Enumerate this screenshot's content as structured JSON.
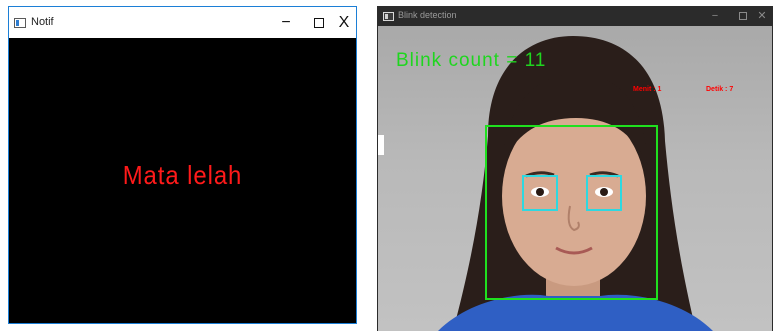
{
  "notif_window": {
    "title": "Notif",
    "controls": {
      "minimize": "−",
      "close": "X"
    },
    "message": "Mata lelah"
  },
  "blink_window": {
    "title": "Blink detection",
    "controls": {
      "minimize": "−",
      "close": "✕"
    },
    "blink_count_text": "Blink count = 11",
    "menit_text": "Menit : 1",
    "detik_text": "Detik : 7"
  },
  "colors": {
    "message_red": "#ff1a1a",
    "blink_count_green": "#1fd61f",
    "face_box_green": "#1fe01f",
    "eye_box_cyan": "#2fd8e0",
    "timer_red": "#ff0000"
  },
  "icons": [
    "window-app-icon",
    "minimize-icon",
    "maximize-icon",
    "close-icon"
  ]
}
